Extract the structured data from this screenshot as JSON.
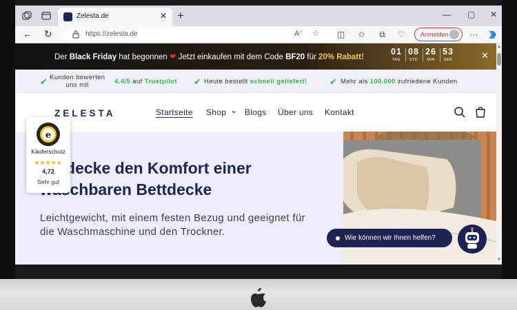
{
  "browser": {
    "tab_title": "Zelesta.de",
    "tab_close": "✕",
    "new_tab": "+",
    "url": "https://zelesta.de",
    "signin_label": "Anmelden",
    "window_controls": {
      "minimize": "—",
      "maximize": "▢",
      "close": "✕"
    }
  },
  "promo": {
    "part1": "Der ",
    "bold1": "Black Friday",
    "part2": " hat begonnen ",
    "heart": "❤",
    "part3": " Jetzt einkaufen mit dem Code ",
    "code": "BF20",
    "part4": " für ",
    "discount": "20% Rabatt!",
    "countdown": [
      {
        "value": "01",
        "label": "TAG"
      },
      {
        "value": "08",
        "label": "STD"
      },
      {
        "value": "26",
        "label": "MIN"
      },
      {
        "value": "53",
        "label": "SEK"
      }
    ],
    "close": "✕"
  },
  "trust_bar": {
    "item1_line1": "Kunden bewerten",
    "item1_line2": "uns mit",
    "item1_rating": "4.4/5",
    "item1_mid": " auf ",
    "item1_brand": "Trustpilot",
    "item2_text": "Heute bestellt ",
    "item2_green": "schnell geliefert!",
    "item3_text": "Mehr als ",
    "item3_green": "100.000",
    "item3_rest": " zufriedene Kunden",
    "check": "✔"
  },
  "site": {
    "logo": "ZELESTA",
    "nav": [
      "Startseite",
      "Shop",
      "Blogs",
      "Über uns",
      "Kontakt"
    ],
    "shop_chevron": "⌄"
  },
  "hero": {
    "headline": "Entdecke den Komfort einer waschbaren Bettdecke",
    "subtext": "Leichtgewicht, mit einem festen Bezug und geeignet für die Waschmaschine und den Trockner."
  },
  "badge": {
    "label": "Käuferschutz",
    "stars": "★★★★★",
    "rating": "4,72",
    "rating_text": "Sehr gut"
  },
  "chat": {
    "label": "Wie können wir Ihnen helfen?"
  },
  "colors": {
    "brand_navy": "#1e2452",
    "accent_green": "#3cb24a",
    "promo_gold": "#f6c34a",
    "heart_red": "#e12b2b"
  }
}
